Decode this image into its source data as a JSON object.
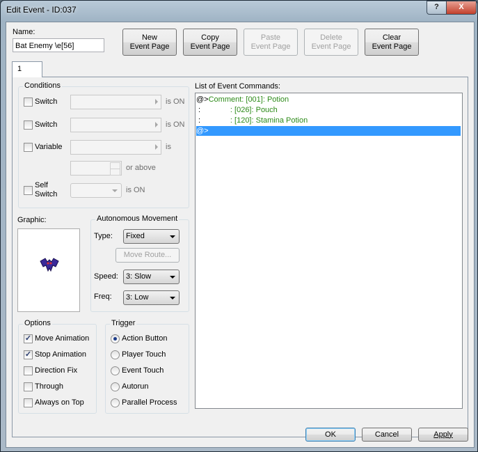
{
  "window": {
    "title": "Edit Event - ID:037",
    "help": "?",
    "close": "X"
  },
  "name_label": "Name:",
  "name_value": "Bat Enemy \\e[56]",
  "toolbar": {
    "new": [
      "New",
      "Event Page"
    ],
    "copy": [
      "Copy",
      "Event Page"
    ],
    "paste": [
      "Paste",
      "Event Page"
    ],
    "delete": [
      "Delete",
      "Event Page"
    ],
    "clear": [
      "Clear",
      "Event Page"
    ]
  },
  "tab_label": "1",
  "conditions": {
    "title": "Conditions",
    "switch1": {
      "label": "Switch",
      "suffix": "is ON"
    },
    "switch2": {
      "label": "Switch",
      "suffix": "is ON"
    },
    "variable": {
      "label": "Variable",
      "suffix": "is",
      "above": "or above"
    },
    "self_switch": {
      "label1": "Self",
      "label2": "Switch",
      "suffix": "is ON"
    }
  },
  "graphic_label": "Graphic:",
  "movement": {
    "title": "Autonomous Movement",
    "type_label": "Type:",
    "type_value": "Fixed",
    "move_route": "Move Route...",
    "speed_label": "Speed:",
    "speed_value": "3: Slow",
    "freq_label": "Freq:",
    "freq_value": "3: Low"
  },
  "options": {
    "title": "Options",
    "items": [
      {
        "label": "Move Animation",
        "checked": true
      },
      {
        "label": "Stop Animation",
        "checked": true
      },
      {
        "label": "Direction Fix",
        "checked": false
      },
      {
        "label": "Through",
        "checked": false
      },
      {
        "label": "Always on Top",
        "checked": false
      }
    ]
  },
  "trigger": {
    "title": "Trigger",
    "items": [
      {
        "label": "Action Button",
        "selected": true
      },
      {
        "label": "Player Touch",
        "selected": false
      },
      {
        "label": "Event Touch",
        "selected": false
      },
      {
        "label": "Autorun",
        "selected": false
      },
      {
        "label": "Parallel Process",
        "selected": false
      }
    ]
  },
  "commands": {
    "title": "List of Event Commands:",
    "rows": [
      {
        "prefix": "@>",
        "text": "Comment: [001]: Potion"
      },
      {
        "prefix": " :",
        "text": "              : [026]: Pouch"
      },
      {
        "prefix": " :",
        "text": "              : [120]: Stamina Potion"
      },
      {
        "prefix": "@>",
        "text": ""
      }
    ]
  },
  "footer": {
    "ok": "OK",
    "cancel": "Cancel",
    "apply": "Apply"
  },
  "colors": {
    "selection": "#3399ff",
    "comment": "#2c8a18",
    "bat": "#3a2a9a"
  }
}
